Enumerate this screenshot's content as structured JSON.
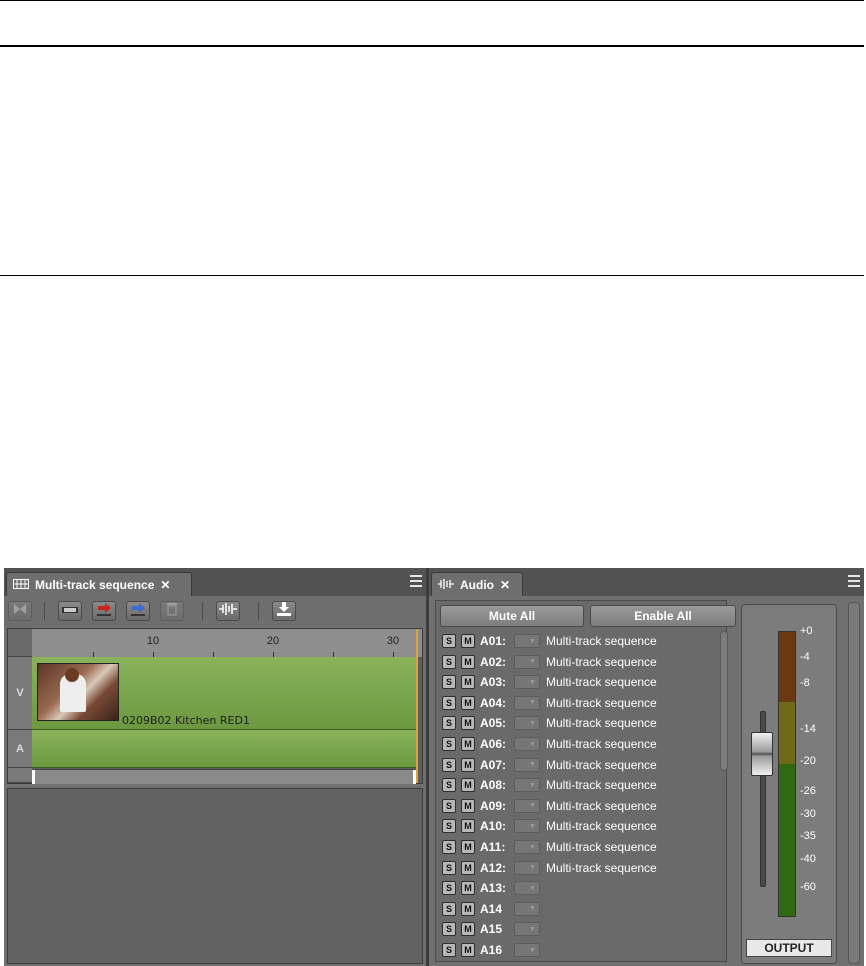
{
  "timeline_panel": {
    "tab_title": "Multi-track sequence",
    "tab_icon": "timeline-icon",
    "ruler_labels": [
      "10",
      "20",
      "30"
    ],
    "tracks": [
      {
        "name": "V",
        "type": "video"
      },
      {
        "name": "A",
        "type": "audio"
      }
    ],
    "clip": {
      "name": "0209B02 Kitchen RED1"
    },
    "toolbar_icons": [
      "mark-in-out-icon",
      "clip-icon",
      "overwrite-icon",
      "splice-icon",
      "trash-icon",
      "audio-waveform-icon",
      "export-icon"
    ]
  },
  "audio_panel": {
    "tab_title": "Audio",
    "tab_icon": "audio-waveform-icon",
    "mute_all_label": "Mute All",
    "enable_all_label": "Enable All",
    "solo_label": "S",
    "mute_label": "M",
    "channels": [
      {
        "name": "A01:",
        "source": "Multi-track sequence"
      },
      {
        "name": "A02:",
        "source": "Multi-track sequence"
      },
      {
        "name": "A03:",
        "source": "Multi-track sequence"
      },
      {
        "name": "A04:",
        "source": "Multi-track sequence"
      },
      {
        "name": "A05:",
        "source": "Multi-track sequence"
      },
      {
        "name": "A06:",
        "source": "Multi-track sequence"
      },
      {
        "name": "A07:",
        "source": "Multi-track sequence"
      },
      {
        "name": "A08:",
        "source": "Multi-track sequence"
      },
      {
        "name": "A09:",
        "source": "Multi-track sequence"
      },
      {
        "name": "A10:",
        "source": "Multi-track sequence"
      },
      {
        "name": "A11:",
        "source": "Multi-track sequence"
      },
      {
        "name": "A12:",
        "source": "Multi-track sequence"
      },
      {
        "name": "A13:",
        "source": ""
      },
      {
        "name": "A14",
        "source": ""
      },
      {
        "name": "A15",
        "source": ""
      },
      {
        "name": "A16",
        "source": ""
      }
    ],
    "meter_scale": [
      "+0",
      "-4",
      "-8",
      "-14",
      "-20",
      "-26",
      "-30",
      "-35",
      "-40",
      "-60"
    ],
    "output_label": "OUTPUT",
    "colors": {
      "meter_red": "#6b3a12",
      "meter_yellow": "#6e6a1a",
      "meter_green": "#2f6a12",
      "track_green": "#7aa64c"
    }
  }
}
